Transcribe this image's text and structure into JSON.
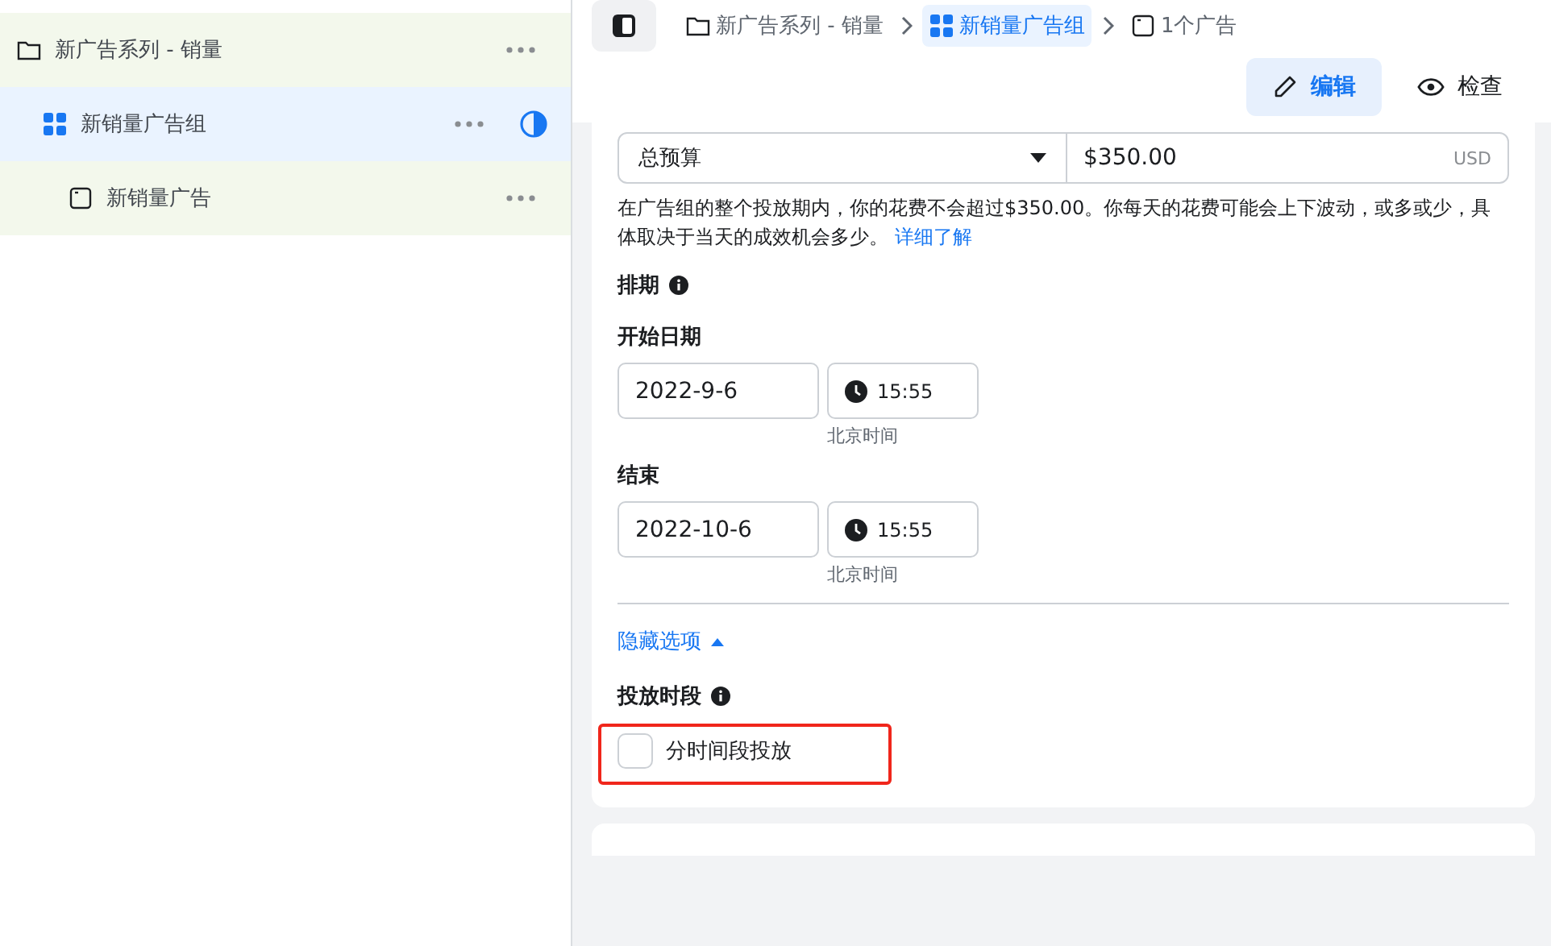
{
  "tree": [
    {
      "kind": "campaign",
      "label": "新广告系列 - 销量",
      "selected": false,
      "status": false,
      "children": [
        {
          "kind": "adset",
          "label": "新销量广告组",
          "selected": true,
          "status": true,
          "children": [
            {
              "kind": "ad",
              "label": "新销量广告",
              "selected": false,
              "status": false
            }
          ]
        }
      ]
    }
  ],
  "breadcrumb": [
    {
      "kind": "campaign",
      "label": "新广告系列 - 销量",
      "selected": false
    },
    {
      "kind": "adset",
      "label": "新销量广告组",
      "selected": true
    },
    {
      "kind": "ad",
      "label": "1个广告",
      "selected": false
    }
  ],
  "modes": [
    {
      "kind": "edit",
      "label": "编辑",
      "selected": true
    },
    {
      "kind": "view",
      "label": "检查",
      "selected": false
    }
  ],
  "budget": {
    "type": "总预算",
    "amount": "$350.00",
    "currency": "USD",
    "note": "在广告组的整个投放期内，你的花费不会超过$350.00。你每天的花费可能会上下波动，或多或少，具体取决于当天的成效机会多少。",
    "link": "详细了解"
  },
  "schedule": {
    "title": "排期",
    "start": {
      "label": "开始日期",
      "date": "2022-9-6",
      "time": "15:55",
      "timezone": "北京时间"
    },
    "end": {
      "label": "结束",
      "date": "2022-10-6",
      "time": "15:55",
      "timezone": "北京时间"
    }
  },
  "options_toggle": {
    "label": "隐藏选项",
    "expanded": true
  },
  "delivery": {
    "title": "投放时段",
    "option": {
      "label": "分时间段投放",
      "checked": false,
      "highlighted": true
    }
  }
}
